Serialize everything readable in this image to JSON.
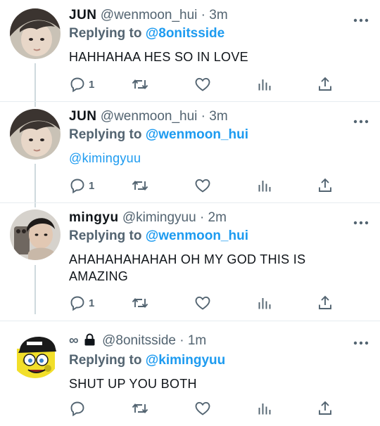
{
  "tweets": [
    {
      "name": "JUN",
      "handle": "@wenmoon_hui",
      "time": " · 3m",
      "reply_prefix": "Replying to ",
      "reply_to": "@8onitsside",
      "text": "HAHHAHAA HES SO IN LOVE",
      "reply_count": "1"
    },
    {
      "name": "JUN",
      "handle": "@wenmoon_hui",
      "time": " · 3m",
      "reply_prefix": "Replying to ",
      "reply_to": "@wenmoon_hui",
      "text": "@kimingyuu",
      "reply_count": "1"
    },
    {
      "name": "mingyu",
      "handle": "@kimingyuu",
      "time": " · 2m",
      "reply_prefix": "Replying to ",
      "reply_to": "@wenmoon_hui",
      "text": "AHAHAHAHAHAH OH MY GOD THIS IS AMAZING",
      "reply_count": "1"
    },
    {
      "name": "∞",
      "handle": "@8onitsside",
      "time": " · 1m",
      "reply_prefix": "Replying to ",
      "reply_to": "@kimingyuu",
      "text": "SHUT UP YOU BOTH",
      "reply_count": ""
    }
  ],
  "icons": {
    "reply": "reply-icon",
    "retweet": "retweet-icon",
    "like": "like-icon",
    "analytics": "analytics-icon",
    "share": "share-icon",
    "more": "more-icon",
    "lock": "lock-icon"
  },
  "colors": {
    "link": "#1d9bf0",
    "secondary": "#536471",
    "text": "#0f1419",
    "thread_line": "#cfd9de"
  }
}
